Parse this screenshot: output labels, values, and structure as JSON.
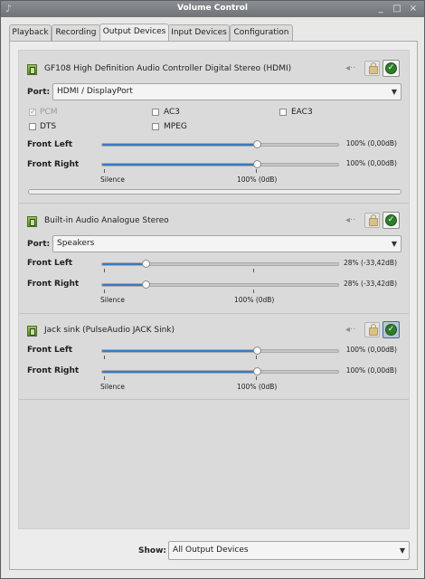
{
  "window": {
    "title": "Volume Control",
    "close_glyph": "×",
    "max_glyph": "□",
    "min_glyph": "_"
  },
  "tabs": [
    {
      "label": "Playback"
    },
    {
      "label": "Recording"
    },
    {
      "label": "Output Devices",
      "active": true
    },
    {
      "label": "Input Devices"
    },
    {
      "label": "Configuration"
    }
  ],
  "devices": [
    {
      "name": "GF108 High Definition Audio Controller Digital Stereo (HDMI)",
      "port_label": "Port:",
      "port_value": "HDMI / DisplayPort",
      "formats": [
        {
          "label": "PCM",
          "checked": true,
          "disabled": true
        },
        {
          "label": "AC3",
          "checked": false
        },
        {
          "label": "EAC3",
          "checked": false
        },
        {
          "label": "DTS",
          "checked": false
        },
        {
          "label": "MPEG",
          "checked": false
        }
      ],
      "channels": [
        {
          "label": "Front Left",
          "percent": 100,
          "value_text": "100% (0,00dB)"
        },
        {
          "label": "Front Right",
          "percent": 100,
          "value_text": "100% (0,00dB)"
        }
      ],
      "marks": {
        "silence": "Silence",
        "unity": "100% (0dB)"
      },
      "default": false
    },
    {
      "name": "Built-in Audio Analogue Stereo",
      "port_label": "Port:",
      "port_value": "Speakers",
      "channels": [
        {
          "label": "Front Left",
          "percent": 28,
          "value_text": "28% (-33,42dB)"
        },
        {
          "label": "Front Right",
          "percent": 28,
          "value_text": "28% (-33,42dB)"
        }
      ],
      "marks": {
        "silence": "Silence",
        "unity": "100% (0dB)"
      },
      "default": false
    },
    {
      "name": "Jack sink (PulseAudio JACK Sink)",
      "channels": [
        {
          "label": "Front Left",
          "percent": 100,
          "value_text": "100% (0,00dB)"
        },
        {
          "label": "Front Right",
          "percent": 100,
          "value_text": "100% (0,00dB)"
        }
      ],
      "marks": {
        "silence": "Silence",
        "unity": "100% (0dB)"
      },
      "default": true
    }
  ],
  "footer": {
    "show_label": "Show:",
    "show_value": "All Output Devices"
  },
  "icons": {
    "mute": "speaker-mute-icon",
    "lock": "lock-icon",
    "default": "check-icon",
    "app": "app-icon"
  },
  "colors": {
    "slider_fill": "#3b78c5",
    "titlebar": "#7d8186",
    "check": "#2f7d2a"
  }
}
